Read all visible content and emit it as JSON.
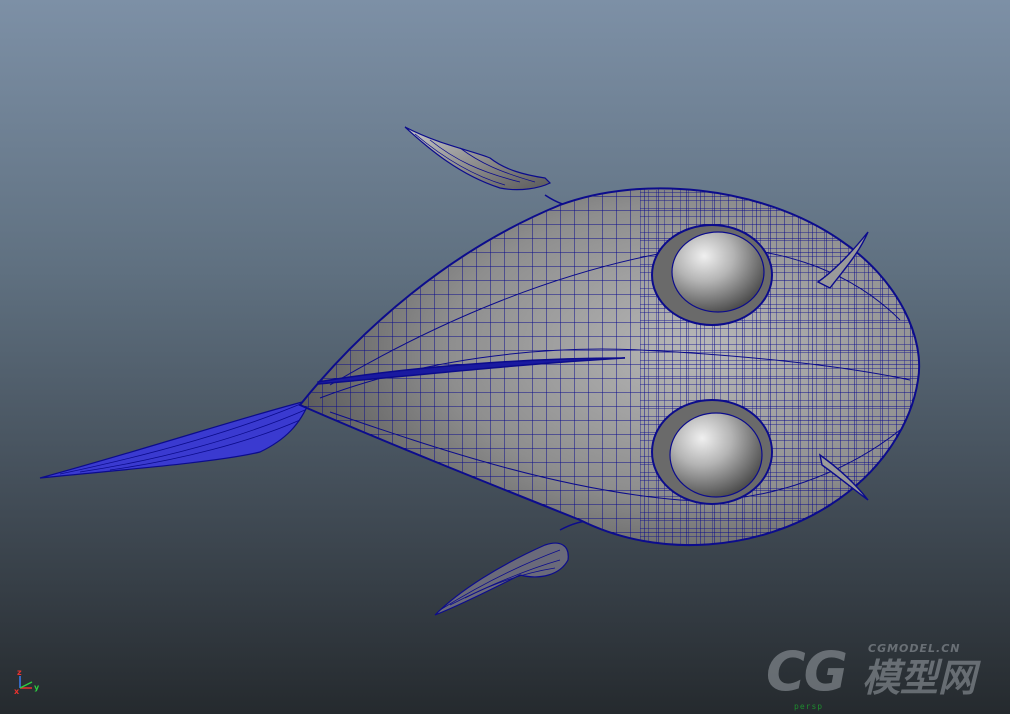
{
  "viewport": {
    "camera_label": "persp",
    "shading": "wireframe-on-shaded",
    "background_top": "#7d90a6",
    "background_bottom": "#252a2e",
    "wire_color": "#0c0c8c",
    "surface_color": "#8e8e8e"
  },
  "axis_gizmo": {
    "z_label": "z",
    "x_label": "x",
    "y_label": "y",
    "x_color": "#e8322e",
    "y_color": "#2ecc40",
    "z_color": "#3a7af0"
  },
  "model": {
    "icon": "fish-mesh-icon"
  },
  "watermark": {
    "logo_text": "CG",
    "url_text": "CGMODEL.CN",
    "cn_text": "模型网"
  }
}
